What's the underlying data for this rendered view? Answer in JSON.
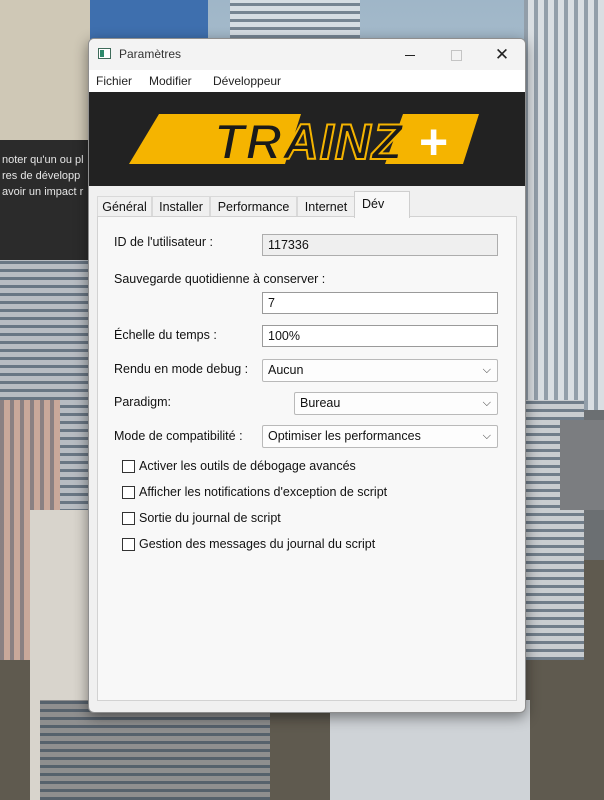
{
  "window": {
    "title": "Paramètres",
    "close_glyph": "✕"
  },
  "menu": [
    "Fichier",
    "Modifier",
    "Développeur"
  ],
  "banner": {
    "logo_text": "TRAINZ",
    "plus": "+"
  },
  "tabs": [
    {
      "label": "Général",
      "active": false
    },
    {
      "label": "Installer",
      "active": false
    },
    {
      "label": "Performance",
      "active": false
    },
    {
      "label": "Internet",
      "active": false
    },
    {
      "label": "Dév",
      "active": true
    }
  ],
  "dev": {
    "user_id_label": "ID de l'utilisateur :",
    "user_id_value": "117336",
    "backup_label": "Sauvegarde quotidienne à conserver :",
    "backup_value": "7",
    "timescale_label": "Échelle du temps :",
    "timescale_value": "100%",
    "debug_render_label": "Rendu en mode debug :",
    "debug_render_value": "Aucun",
    "paradigm_label": "Paradigm:",
    "paradigm_value": "Bureau",
    "compat_label": "Mode de compatibilité :",
    "compat_value": "Optimiser les performances",
    "checkboxes": [
      {
        "label": "Activer les outils de débogage avancés",
        "checked": false
      },
      {
        "label": "Afficher les notifications d'exception de script",
        "checked": false
      },
      {
        "label": "Sortie du journal de script",
        "checked": false
      },
      {
        "label": "Gestion des messages du journal du script",
        "checked": false
      }
    ]
  },
  "background_dialog": {
    "lines": [
      "noter qu'un ou pl",
      "res de développ",
      "avoir un impact r"
    ]
  },
  "colors": {
    "logo_yellow": "#f5b400",
    "banner_bg": "#222222"
  }
}
